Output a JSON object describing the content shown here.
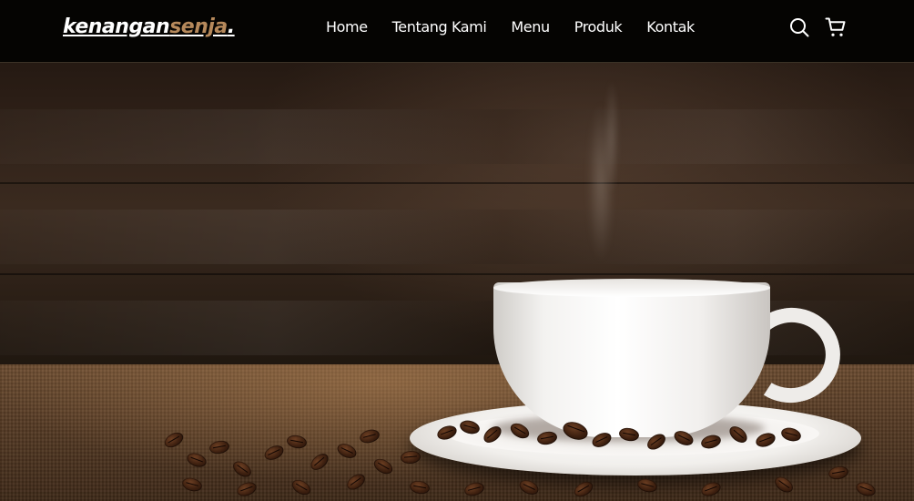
{
  "brand": {
    "logo_main": "kenangan",
    "logo_accent": "senja",
    "logo_dot": ".",
    "accent_color": "#b6895b"
  },
  "nav": {
    "links": [
      {
        "label": "Home"
      },
      {
        "label": "Tentang Kami"
      },
      {
        "label": "Menu"
      },
      {
        "label": "Produk"
      },
      {
        "label": "Kontak"
      }
    ],
    "icons": [
      "search-icon",
      "shopping-cart-icon"
    ]
  },
  "hero": {
    "image": "coffee-cup-on-saucer-with-beans"
  }
}
